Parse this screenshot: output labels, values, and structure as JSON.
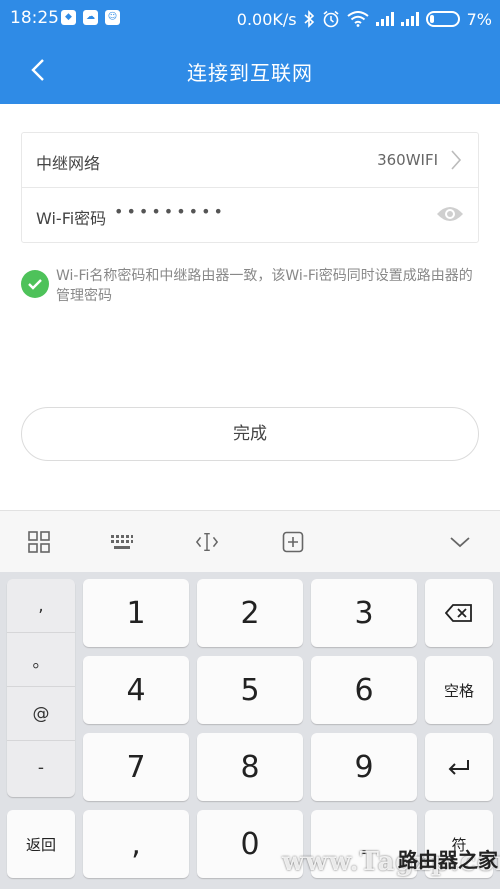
{
  "status_bar": {
    "time": "18:25",
    "net_speed": "0.00K/s",
    "battery": "7%",
    "app_icons": [
      "shield-app",
      "cloud-app",
      "android-app"
    ]
  },
  "header": {
    "title": "连接到互联网",
    "back_icon": "chevron-left-icon"
  },
  "form": {
    "relay_network_label": "中继网络",
    "relay_network_value": "360WIFI",
    "wifi_password_label": "Wi-Fi密码",
    "wifi_password_masked": "•••••••••"
  },
  "note": {
    "text": "Wi-Fi名称密码和中继路由器一致，该Wi-Fi密码同时设置成路由器的管理密码"
  },
  "done_button": {
    "label": "完成"
  },
  "keyboard": {
    "toolbar_icons": [
      "grid-icon",
      "keyboard-icon",
      "cursor-icon",
      "plus-box-icon",
      "chevron-down-icon"
    ],
    "left_column": [
      ",",
      "。",
      "@",
      "-"
    ],
    "digits": [
      "1",
      "2",
      "3",
      "4",
      "5",
      "6",
      "7",
      "8",
      "9"
    ],
    "zero": "0",
    "back_label": "返回",
    "comma_key": ",",
    "dot_key": ".",
    "space_label": "空格",
    "symbol_label": "符",
    "delete_icon": "backspace-icon",
    "enter_icon": "enter-icon"
  },
  "watermark": {
    "latin": "www.Tagxp.com",
    "chinese": "路由器之家"
  },
  "colors": {
    "primary": "#2f8be6",
    "check_green": "#4ec25a",
    "keyboard_bg": "#dfe1e5"
  }
}
